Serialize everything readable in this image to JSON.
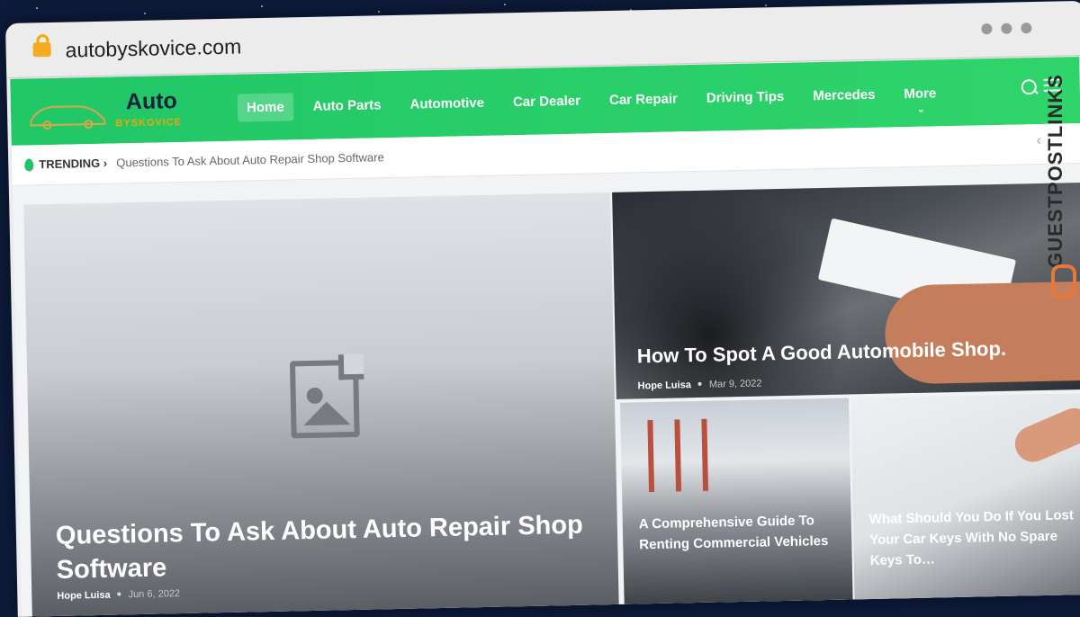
{
  "browser": {
    "url": "autobyskovice.com"
  },
  "site": {
    "logo_title": "Auto",
    "logo_subtitle": "BYSKOVICE"
  },
  "nav": {
    "items": [
      {
        "label": "Home",
        "active": true
      },
      {
        "label": "Auto Parts"
      },
      {
        "label": "Automotive"
      },
      {
        "label": "Car Dealer"
      },
      {
        "label": "Car Repair"
      },
      {
        "label": "Driving Tips"
      },
      {
        "label": "Mercedes"
      },
      {
        "label": "More"
      }
    ]
  },
  "trending": {
    "label": "TRENDING",
    "text": "Questions To Ask About Auto Repair Shop Software"
  },
  "posts": {
    "big": {
      "title": "Questions To Ask About Auto Repair Shop Software",
      "author": "Hope Luisa",
      "date": "Jun 6, 2022"
    },
    "top_right": {
      "title": "How To Spot A Good Automobile Shop.",
      "author": "Hope Luisa",
      "date": "Mar 9, 2022"
    },
    "bottom_middle": {
      "title": "A Comprehensive Guide To Renting Commercial Vehicles"
    },
    "bottom_right": {
      "title": "What Should You Do If You Lost Your Car Keys With No Spare Keys To…"
    }
  },
  "overlay": {
    "brand": "GUESTPOSTLINKS"
  },
  "colors": {
    "nav_green": "#21c767",
    "logo_gold": "#f0a500",
    "brand_orange": "#e8773a"
  }
}
